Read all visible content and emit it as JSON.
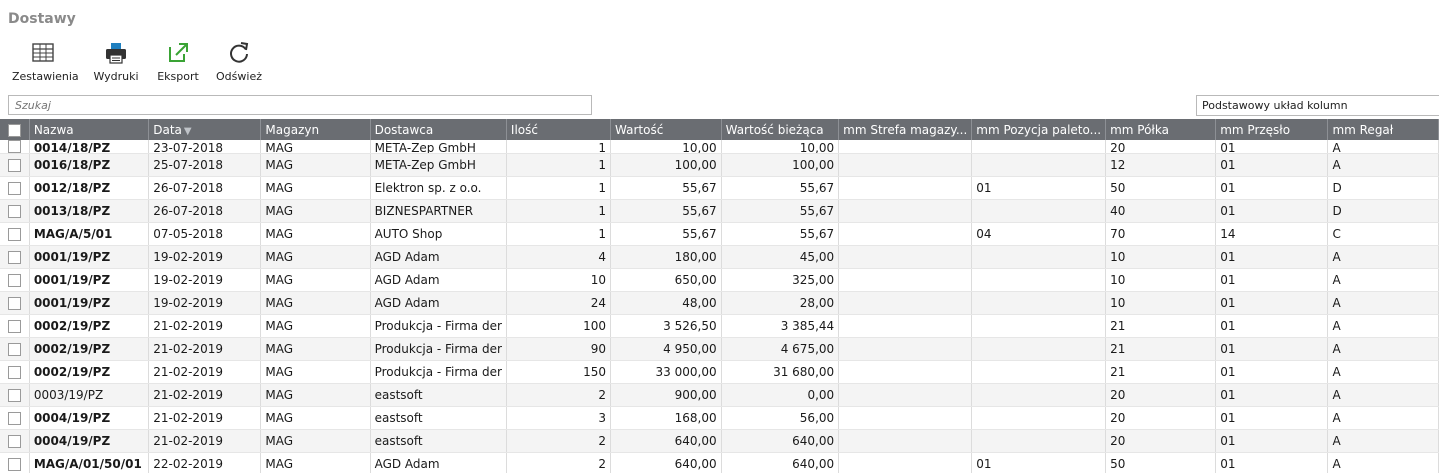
{
  "page": {
    "title": "Dostawy"
  },
  "toolbar": {
    "reports_label": "Zestawienia",
    "prints_label": "Wydruki",
    "export_label": "Eksport",
    "refresh_label": "Odśwież"
  },
  "search": {
    "placeholder": "Szukaj",
    "value": ""
  },
  "layout_select": {
    "value": "Podstawowy układ kolumn"
  },
  "colors": {
    "header_bg": "#6a6d72",
    "export_accent": "#3aa335",
    "print_accent": "#1f7fbf"
  },
  "grid": {
    "columns": [
      "Nazwa",
      "Data",
      "Magazyn",
      "Dostawca",
      "Ilość",
      "Wartość",
      "Wartość bieżąca",
      "mm Strefa magazy...",
      "mm Pozycja paleto...",
      "mm Półka",
      "mm Przęsło",
      "mm Regał"
    ],
    "rows": [
      {
        "nazwa": "0014/18/PZ",
        "bold": true,
        "data": "23-07-2018",
        "magazyn": "MAG",
        "dostawca": "META-Zep GmbH",
        "ilosc": "1",
        "wartosc": "10,00",
        "biezaca": "10,00",
        "strefa": "",
        "pozycja": "",
        "polka": "20",
        "przeslo": "01",
        "regal": "A"
      },
      {
        "nazwa": "0016/18/PZ",
        "bold": true,
        "data": "25-07-2018",
        "magazyn": "MAG",
        "dostawca": "META-Zep GmbH",
        "ilosc": "1",
        "wartosc": "100,00",
        "biezaca": "100,00",
        "strefa": "",
        "pozycja": "",
        "polka": "12",
        "przeslo": "01",
        "regal": "A"
      },
      {
        "nazwa": "0012/18/PZ",
        "bold": true,
        "data": "26-07-2018",
        "magazyn": "MAG",
        "dostawca": "Elektron sp. z o.o.",
        "ilosc": "1",
        "wartosc": "55,67",
        "biezaca": "55,67",
        "strefa": "",
        "pozycja": "01",
        "polka": "50",
        "przeslo": "01",
        "regal": "D"
      },
      {
        "nazwa": "0013/18/PZ",
        "bold": true,
        "data": "26-07-2018",
        "magazyn": "MAG",
        "dostawca": "BIZNESPARTNER",
        "ilosc": "1",
        "wartosc": "55,67",
        "biezaca": "55,67",
        "strefa": "",
        "pozycja": "",
        "polka": "40",
        "przeslo": "01",
        "regal": "D"
      },
      {
        "nazwa": "MAG/A/5/01",
        "bold": true,
        "data": "07-05-2018",
        "magazyn": "MAG",
        "dostawca": "AUTO Shop",
        "ilosc": "1",
        "wartosc": "55,67",
        "biezaca": "55,67",
        "strefa": "",
        "pozycja": "04",
        "polka": "70",
        "przeslo": "14",
        "regal": "C"
      },
      {
        "nazwa": "0001/19/PZ",
        "bold": true,
        "data": "19-02-2019",
        "magazyn": "MAG",
        "dostawca": "AGD Adam",
        "ilosc": "4",
        "wartosc": "180,00",
        "biezaca": "45,00",
        "strefa": "",
        "pozycja": "",
        "polka": "10",
        "przeslo": "01",
        "regal": "A"
      },
      {
        "nazwa": "0001/19/PZ",
        "bold": true,
        "data": "19-02-2019",
        "magazyn": "MAG",
        "dostawca": "AGD Adam",
        "ilosc": "10",
        "wartosc": "650,00",
        "biezaca": "325,00",
        "strefa": "",
        "pozycja": "",
        "polka": "10",
        "przeslo": "01",
        "regal": "A"
      },
      {
        "nazwa": "0001/19/PZ",
        "bold": true,
        "data": "19-02-2019",
        "magazyn": "MAG",
        "dostawca": "AGD Adam",
        "ilosc": "24",
        "wartosc": "48,00",
        "biezaca": "28,00",
        "strefa": "",
        "pozycja": "",
        "polka": "10",
        "przeslo": "01",
        "regal": "A"
      },
      {
        "nazwa": "0002/19/PZ",
        "bold": true,
        "data": "21-02-2019",
        "magazyn": "MAG",
        "dostawca": "Produkcja - Firma der",
        "ilosc": "100",
        "wartosc": "3 526,50",
        "biezaca": "3 385,44",
        "strefa": "",
        "pozycja": "",
        "polka": "21",
        "przeslo": "01",
        "regal": "A"
      },
      {
        "nazwa": "0002/19/PZ",
        "bold": true,
        "data": "21-02-2019",
        "magazyn": "MAG",
        "dostawca": "Produkcja - Firma der",
        "ilosc": "90",
        "wartosc": "4 950,00",
        "biezaca": "4 675,00",
        "strefa": "",
        "pozycja": "",
        "polka": "21",
        "przeslo": "01",
        "regal": "A"
      },
      {
        "nazwa": "0002/19/PZ",
        "bold": true,
        "data": "21-02-2019",
        "magazyn": "MAG",
        "dostawca": "Produkcja - Firma der",
        "ilosc": "150",
        "wartosc": "33 000,00",
        "biezaca": "31 680,00",
        "strefa": "",
        "pozycja": "",
        "polka": "21",
        "przeslo": "01",
        "regal": "A"
      },
      {
        "nazwa": "0003/19/PZ",
        "bold": false,
        "data": "21-02-2019",
        "magazyn": "MAG",
        "dostawca": "eastsoft",
        "ilosc": "2",
        "wartosc": "900,00",
        "biezaca": "0,00",
        "strefa": "",
        "pozycja": "",
        "polka": "20",
        "przeslo": "01",
        "regal": "A"
      },
      {
        "nazwa": "0004/19/PZ",
        "bold": true,
        "data": "21-02-2019",
        "magazyn": "MAG",
        "dostawca": "eastsoft",
        "ilosc": "3",
        "wartosc": "168,00",
        "biezaca": "56,00",
        "strefa": "",
        "pozycja": "",
        "polka": "20",
        "przeslo": "01",
        "regal": "A"
      },
      {
        "nazwa": "0004/19/PZ",
        "bold": true,
        "data": "21-02-2019",
        "magazyn": "MAG",
        "dostawca": "eastsoft",
        "ilosc": "2",
        "wartosc": "640,00",
        "biezaca": "640,00",
        "strefa": "",
        "pozycja": "",
        "polka": "20",
        "przeslo": "01",
        "regal": "A"
      },
      {
        "nazwa": "MAG/A/01/50/01",
        "bold": true,
        "data": "22-02-2019",
        "magazyn": "MAG",
        "dostawca": "AGD Adam",
        "ilosc": "2",
        "wartosc": "640,00",
        "biezaca": "640,00",
        "strefa": "",
        "pozycja": "01",
        "polka": "50",
        "przeslo": "01",
        "regal": "A"
      }
    ]
  }
}
